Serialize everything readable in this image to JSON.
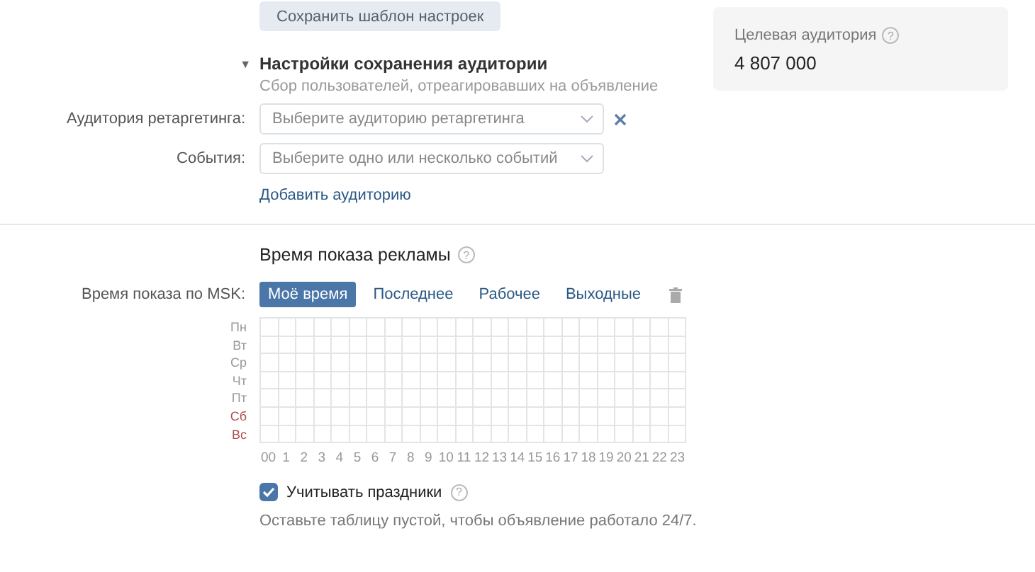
{
  "save_template_button": "Сохранить шаблон настроек",
  "audience_card": {
    "title": "Целевая аудитория",
    "help": "?",
    "value": "4 807 000"
  },
  "audience_saving": {
    "expanded": true,
    "toggle": "▼",
    "title": "Настройки сохранения аудитории",
    "subtitle": "Сбор пользователей, отреагировавших на объявление",
    "fields": [
      {
        "label": "Аудитория ретаргетинга:",
        "placeholder": "Выберите аудиторию ретаргетинга",
        "removable": true
      },
      {
        "label": "События:",
        "placeholder": "Выберите одно или несколько событий",
        "removable": false
      }
    ],
    "add_link": "Добавить аудиторию"
  },
  "ad_schedule": {
    "title": "Время показа рекламы",
    "help": "?",
    "preset_label": "Время показа по MSK:",
    "presets": [
      {
        "label": "Моё время",
        "selected": true
      },
      {
        "label": "Последнее",
        "selected": false
      },
      {
        "label": "Рабочее",
        "selected": false
      },
      {
        "label": "Выходные",
        "selected": false
      }
    ],
    "days": [
      {
        "label": "Пн",
        "weekend": false
      },
      {
        "label": "Вт",
        "weekend": false
      },
      {
        "label": "Ср",
        "weekend": false
      },
      {
        "label": "Чт",
        "weekend": false
      },
      {
        "label": "Пт",
        "weekend": false
      },
      {
        "label": "Сб",
        "weekend": true
      },
      {
        "label": "Вс",
        "weekend": true
      }
    ],
    "hours": [
      "00",
      "1",
      "2",
      "3",
      "4",
      "5",
      "6",
      "7",
      "8",
      "9",
      "10",
      "11",
      "12",
      "13",
      "14",
      "15",
      "16",
      "17",
      "18",
      "19",
      "20",
      "21",
      "22",
      "23"
    ],
    "holidays": {
      "label": "Учитывать праздники",
      "checked": true,
      "help": "?"
    },
    "hint": "Оставьте таблицу пустой, чтобы объявление работало 24/7."
  }
}
